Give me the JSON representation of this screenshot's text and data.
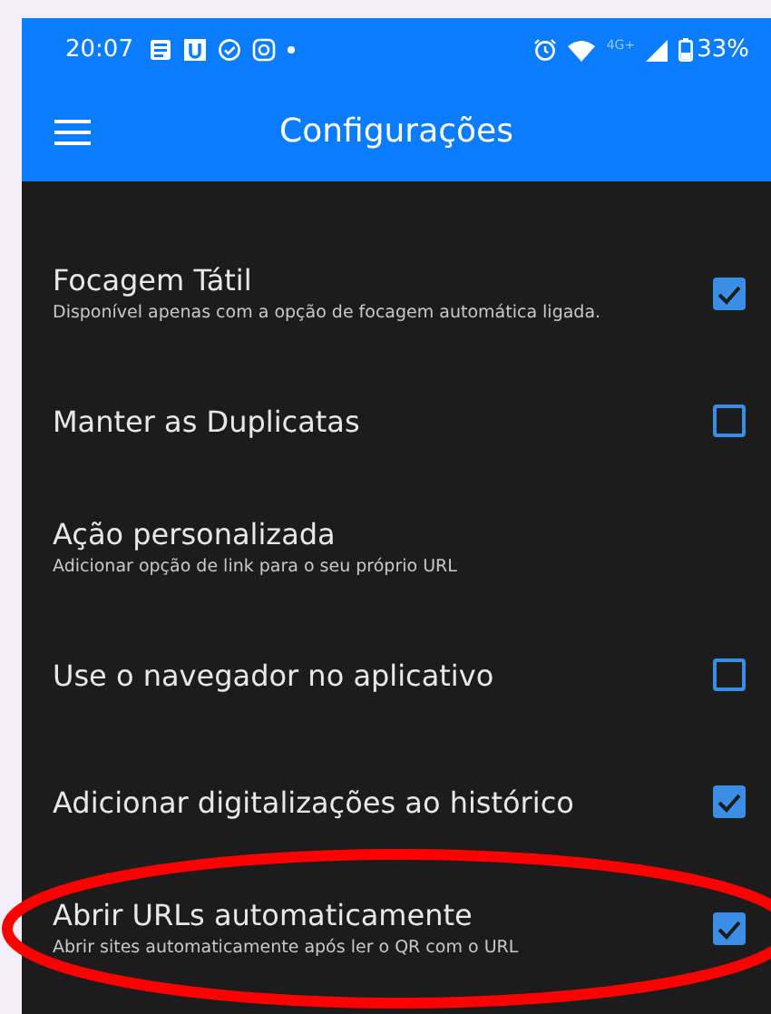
{
  "status_bar": {
    "time": "20:07",
    "network": "4G+",
    "battery": "33%"
  },
  "toolbar": {
    "title": "Configurações"
  },
  "settings": [
    {
      "kind": "checkbox",
      "title": "Focagem Tátil",
      "description": "Disponível apenas com a opção de focagem automática ligada.",
      "checked": true
    },
    {
      "kind": "checkbox",
      "title": "Manter as Duplicatas",
      "checked": false
    },
    {
      "kind": "action",
      "title": "Ação personalizada",
      "description": "Adicionar opção de link para o seu próprio URL"
    },
    {
      "kind": "checkbox",
      "title": "Use o navegador no aplicativo",
      "checked": false
    },
    {
      "kind": "checkbox",
      "title": "Adicionar digitalizações ao histórico",
      "checked": true
    },
    {
      "kind": "checkbox",
      "title": "Abrir URLs automaticamente",
      "description": "Abrir sites automaticamente após ler o QR com o URL",
      "checked": true,
      "highlighted": true
    }
  ]
}
